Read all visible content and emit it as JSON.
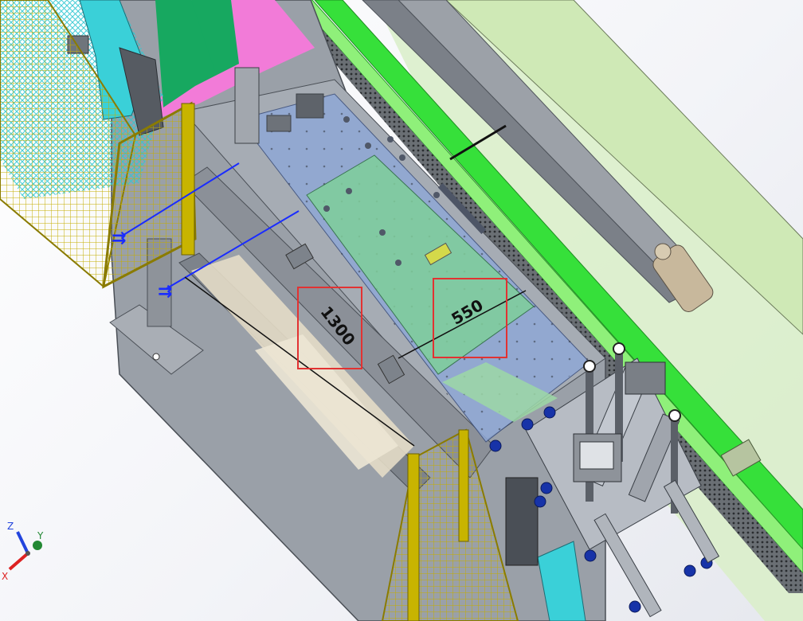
{
  "viewport": {
    "dimensions": [
      {
        "label": "1300"
      },
      {
        "label": "550"
      }
    ],
    "triad": {
      "x_label": "X",
      "y_label": "Y",
      "z_label": "Z"
    }
  },
  "colors": {
    "frame_gray": "#8c9199",
    "frame_dark": "#5f646c",
    "bed_blue": "#8fa8d6",
    "plate_green": "#7fcf9a",
    "rail_green": "#36e03a",
    "guard_yellow": "#c8b400",
    "cyan_part": "#3ad0d8",
    "pink_panel": "#f27bd8",
    "green_panel": "#17a860",
    "highlight_red": "#e23232",
    "dimension_blue": "#1a2cff"
  }
}
